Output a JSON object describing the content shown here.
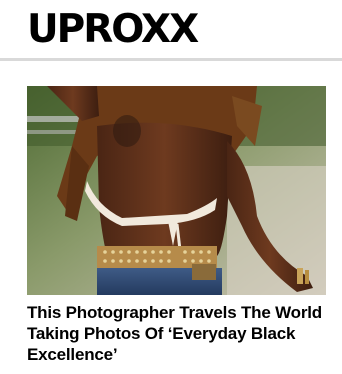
{
  "site": {
    "logo_text": "UPROXX"
  },
  "article": {
    "image_subject": "photo-of-woman-in-halter-top-and-studded-belt",
    "headline": "This Photographer Travels The World Taking Photos Of ‘Everyday Black Excellence’"
  },
  "colors": {
    "logo": "#000000",
    "header_rule": "#d9d9d9",
    "headline": "#000000"
  }
}
